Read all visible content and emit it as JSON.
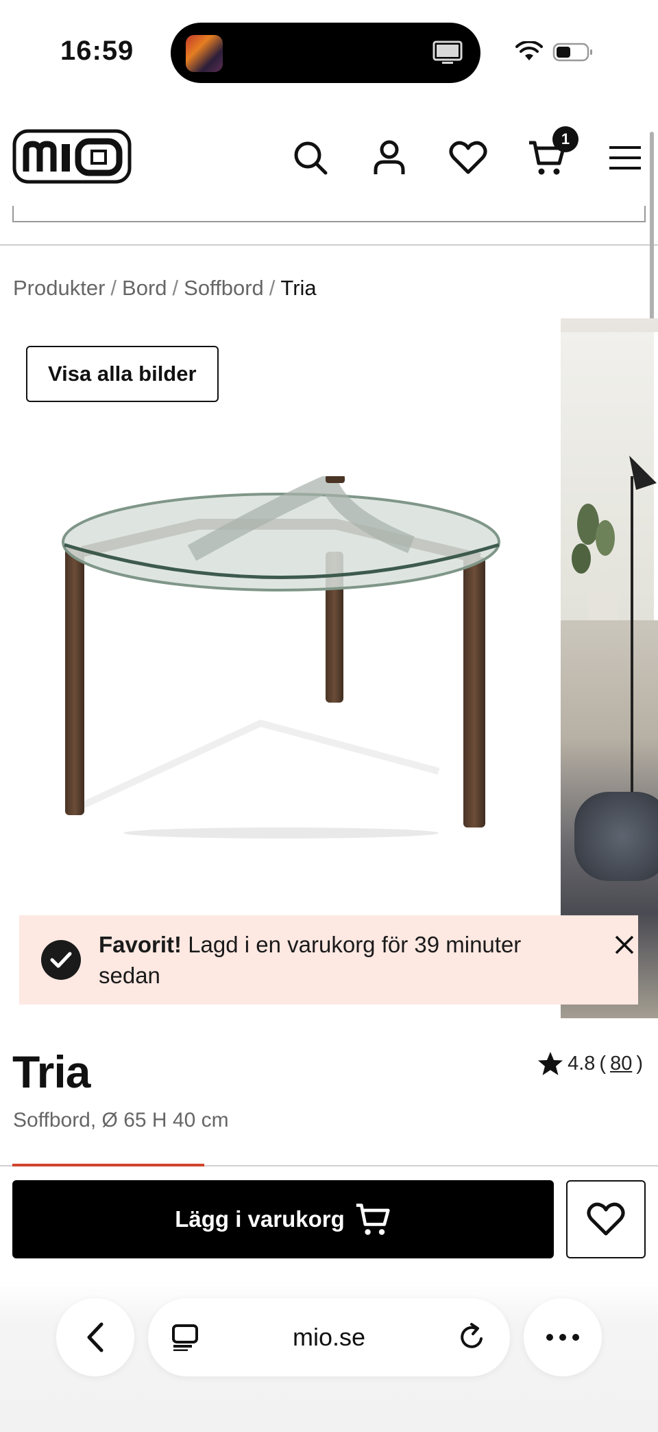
{
  "status_bar": {
    "time": "16:59"
  },
  "header": {
    "logo_text": "mio",
    "cart_count": "1",
    "icons": [
      "search-icon",
      "account-icon",
      "heart-icon",
      "cart-icon",
      "menu-icon"
    ]
  },
  "breadcrumb": {
    "items": [
      "Produkter",
      "Bord",
      "Soffbord"
    ],
    "separator": "/",
    "current": "Tria"
  },
  "gallery": {
    "view_all_label": "Visa alla bilder"
  },
  "toast": {
    "title": "Favorit!",
    "message": "Lagd i en varukorg för 39 minuter sedan"
  },
  "product": {
    "title": "Tria",
    "subtitle": "Soffbord, Ø 65 H 40 cm",
    "rating": "4.8",
    "review_count": "80",
    "add_to_cart_label": "Lägg i varukorg"
  },
  "browser": {
    "url": "mio.se"
  },
  "colors": {
    "accent": "#d0442b",
    "toast_bg": "#fde8e2",
    "primary_button": "#000000"
  }
}
